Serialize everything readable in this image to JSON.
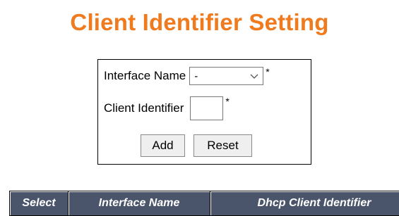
{
  "page": {
    "title": "Client Identifier Setting"
  },
  "form": {
    "interface_name": {
      "label": "Interface Name",
      "selected": "-",
      "required_mark": "*"
    },
    "client_identifier": {
      "label": "Client Identifier",
      "value": "",
      "required_mark": "*"
    },
    "buttons": {
      "add": "Add",
      "reset": "Reset"
    }
  },
  "table": {
    "columns": [
      "Select",
      "Interface Name",
      "Dhcp Client Identifier"
    ]
  },
  "colors": {
    "title": "#f07a1e",
    "table_header_bg": "#4a556b",
    "table_header_text": "#ffffff"
  },
  "icons": {
    "dropdown": "chevron-down-icon"
  }
}
